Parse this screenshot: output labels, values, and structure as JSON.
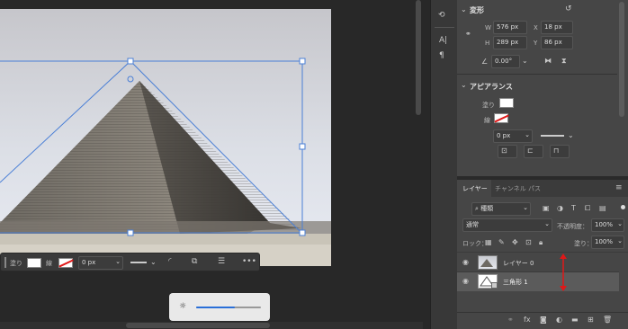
{
  "colors": {
    "accent": "#4a7fd6",
    "arrow": "#e01818",
    "canvas_bg": "#282828",
    "panel_bg": "#464646",
    "field_bg": "#3c3c3c"
  },
  "context_bar": {
    "fill_label": "塗り",
    "stroke_label": "線",
    "stroke_width": "0 px"
  },
  "transform_panel": {
    "title": "変形",
    "w_label": "W",
    "w_value": "576 px",
    "x_label": "X",
    "x_value": "18 px",
    "h_label": "H",
    "h_value": "289 px",
    "y_label": "Y",
    "y_value": "86 px",
    "angle_value": "0.00°"
  },
  "appearance_panel": {
    "title": "アピアランス",
    "fill_label": "塗り",
    "stroke_label": "線",
    "stroke_width": "0 px"
  },
  "layers_panel": {
    "tabs": [
      {
        "label": "レイヤー"
      },
      {
        "label": "チャンネル"
      },
      {
        "label": "パス"
      }
    ],
    "filter_kind": "種類",
    "blend_mode": "通常",
    "opacity_label": "不透明度：",
    "opacity_value": "100%",
    "lock_label": "ロック：",
    "fill_label": "塗り：",
    "fill_value": "100%",
    "layers": [
      {
        "name": "レイヤー 0"
      },
      {
        "name": "三角形 1"
      }
    ]
  },
  "zoom_popup": {
    "level": 0.6
  }
}
